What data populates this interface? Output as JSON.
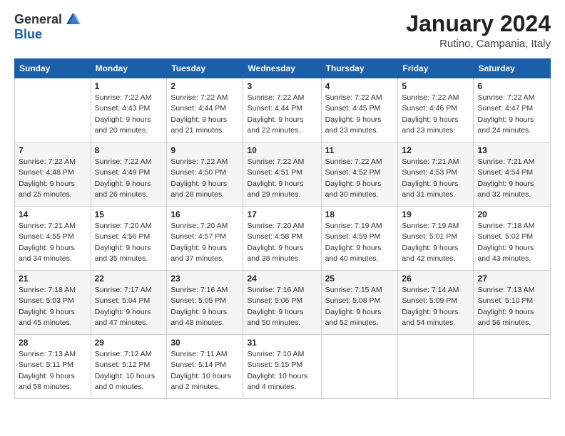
{
  "header": {
    "logo_general": "General",
    "logo_blue": "Blue",
    "month_title": "January 2024",
    "location": "Rutino, Campania, Italy"
  },
  "days_of_week": [
    "Sunday",
    "Monday",
    "Tuesday",
    "Wednesday",
    "Thursday",
    "Friday",
    "Saturday"
  ],
  "weeks": [
    [
      {
        "day": "",
        "info": ""
      },
      {
        "day": "1",
        "info": "Sunrise: 7:22 AM\nSunset: 4:43 PM\nDaylight: 9 hours\nand 20 minutes."
      },
      {
        "day": "2",
        "info": "Sunrise: 7:22 AM\nSunset: 4:44 PM\nDaylight: 9 hours\nand 21 minutes."
      },
      {
        "day": "3",
        "info": "Sunrise: 7:22 AM\nSunset: 4:44 PM\nDaylight: 9 hours\nand 22 minutes."
      },
      {
        "day": "4",
        "info": "Sunrise: 7:22 AM\nSunset: 4:45 PM\nDaylight: 9 hours\nand 23 minutes."
      },
      {
        "day": "5",
        "info": "Sunrise: 7:22 AM\nSunset: 4:46 PM\nDaylight: 9 hours\nand 23 minutes."
      },
      {
        "day": "6",
        "info": "Sunrise: 7:22 AM\nSunset: 4:47 PM\nDaylight: 9 hours\nand 24 minutes."
      }
    ],
    [
      {
        "day": "7",
        "info": "Sunrise: 7:22 AM\nSunset: 4:48 PM\nDaylight: 9 hours\nand 25 minutes."
      },
      {
        "day": "8",
        "info": "Sunrise: 7:22 AM\nSunset: 4:49 PM\nDaylight: 9 hours\nand 26 minutes."
      },
      {
        "day": "9",
        "info": "Sunrise: 7:22 AM\nSunset: 4:50 PM\nDaylight: 9 hours\nand 28 minutes."
      },
      {
        "day": "10",
        "info": "Sunrise: 7:22 AM\nSunset: 4:51 PM\nDaylight: 9 hours\nand 29 minutes."
      },
      {
        "day": "11",
        "info": "Sunrise: 7:22 AM\nSunset: 4:52 PM\nDaylight: 9 hours\nand 30 minutes."
      },
      {
        "day": "12",
        "info": "Sunrise: 7:21 AM\nSunset: 4:53 PM\nDaylight: 9 hours\nand 31 minutes."
      },
      {
        "day": "13",
        "info": "Sunrise: 7:21 AM\nSunset: 4:54 PM\nDaylight: 9 hours\nand 32 minutes."
      }
    ],
    [
      {
        "day": "14",
        "info": "Sunrise: 7:21 AM\nSunset: 4:55 PM\nDaylight: 9 hours\nand 34 minutes."
      },
      {
        "day": "15",
        "info": "Sunrise: 7:20 AM\nSunset: 4:56 PM\nDaylight: 9 hours\nand 35 minutes."
      },
      {
        "day": "16",
        "info": "Sunrise: 7:20 AM\nSunset: 4:57 PM\nDaylight: 9 hours\nand 37 minutes."
      },
      {
        "day": "17",
        "info": "Sunrise: 7:20 AM\nSunset: 4:58 PM\nDaylight: 9 hours\nand 38 minutes."
      },
      {
        "day": "18",
        "info": "Sunrise: 7:19 AM\nSunset: 4:59 PM\nDaylight: 9 hours\nand 40 minutes."
      },
      {
        "day": "19",
        "info": "Sunrise: 7:19 AM\nSunset: 5:01 PM\nDaylight: 9 hours\nand 42 minutes."
      },
      {
        "day": "20",
        "info": "Sunrise: 7:18 AM\nSunset: 5:02 PM\nDaylight: 9 hours\nand 43 minutes."
      }
    ],
    [
      {
        "day": "21",
        "info": "Sunrise: 7:18 AM\nSunset: 5:03 PM\nDaylight: 9 hours\nand 45 minutes."
      },
      {
        "day": "22",
        "info": "Sunrise: 7:17 AM\nSunset: 5:04 PM\nDaylight: 9 hours\nand 47 minutes."
      },
      {
        "day": "23",
        "info": "Sunrise: 7:16 AM\nSunset: 5:05 PM\nDaylight: 9 hours\nand 48 minutes."
      },
      {
        "day": "24",
        "info": "Sunrise: 7:16 AM\nSunset: 5:06 PM\nDaylight: 9 hours\nand 50 minutes."
      },
      {
        "day": "25",
        "info": "Sunrise: 7:15 AM\nSunset: 5:08 PM\nDaylight: 9 hours\nand 52 minutes."
      },
      {
        "day": "26",
        "info": "Sunrise: 7:14 AM\nSunset: 5:09 PM\nDaylight: 9 hours\nand 54 minutes."
      },
      {
        "day": "27",
        "info": "Sunrise: 7:13 AM\nSunset: 5:10 PM\nDaylight: 9 hours\nand 56 minutes."
      }
    ],
    [
      {
        "day": "28",
        "info": "Sunrise: 7:13 AM\nSunset: 5:11 PM\nDaylight: 9 hours\nand 58 minutes."
      },
      {
        "day": "29",
        "info": "Sunrise: 7:12 AM\nSunset: 5:12 PM\nDaylight: 10 hours\nand 0 minutes."
      },
      {
        "day": "30",
        "info": "Sunrise: 7:11 AM\nSunset: 5:14 PM\nDaylight: 10 hours\nand 2 minutes."
      },
      {
        "day": "31",
        "info": "Sunrise: 7:10 AM\nSunset: 5:15 PM\nDaylight: 10 hours\nand 4 minutes."
      },
      {
        "day": "",
        "info": ""
      },
      {
        "day": "",
        "info": ""
      },
      {
        "day": "",
        "info": ""
      }
    ]
  ]
}
